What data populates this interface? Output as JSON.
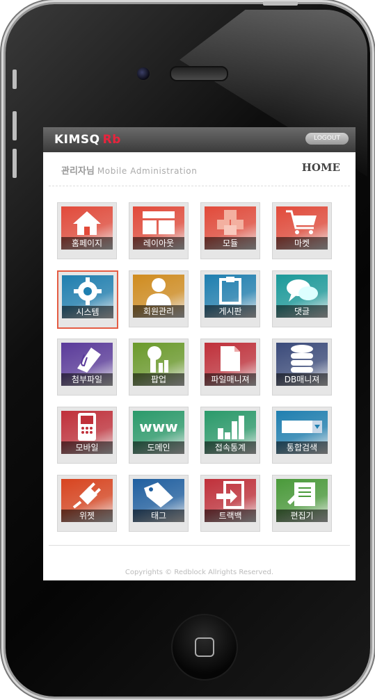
{
  "header": {
    "logo": "KIMSQ",
    "logo_rb": "Rb",
    "logout_label": "LOGOUT"
  },
  "subheader": {
    "admin_label": "관리자님",
    "admin_sub": "Mobile Administration",
    "home_label": "HOME"
  },
  "menu": {
    "items": [
      {
        "label": "홈페이지",
        "icon": "home-icon",
        "color": "#e24a3a"
      },
      {
        "label": "레이아웃",
        "icon": "layout-icon",
        "color": "#e24a3a"
      },
      {
        "label": "모듈",
        "icon": "module-boxes-icon",
        "color": "#e24a3a"
      },
      {
        "label": "마켓",
        "icon": "cart-icon",
        "color": "#e24a3a"
      },
      {
        "label": "시스템",
        "icon": "gear-icon",
        "color": "#1f7fb0",
        "selected": true
      },
      {
        "label": "회원관리",
        "icon": "user-icon",
        "color": "#d08c1f"
      },
      {
        "label": "게시판",
        "icon": "clipboard-icon",
        "color": "#1f7fb0"
      },
      {
        "label": "댓글",
        "icon": "comment-icon",
        "color": "#1b9a9a"
      },
      {
        "label": "첨부파일",
        "icon": "clip-icon",
        "color": "#5a3a9a"
      },
      {
        "label": "팝업",
        "icon": "popup-icon",
        "color": "#6a9a2a"
      },
      {
        "label": "파일매니져",
        "icon": "file-icon",
        "color": "#c0303a"
      },
      {
        "label": "DB매니져",
        "icon": "database-icon",
        "color": "#3a4a7a"
      },
      {
        "label": "모바일",
        "icon": "mobile-icon",
        "color": "#c0303a"
      },
      {
        "label": "도메인",
        "icon": "www-icon",
        "color": "#2a9a6a"
      },
      {
        "label": "접속통계",
        "icon": "bar-chart-icon",
        "color": "#2a9a6a"
      },
      {
        "label": "통합검색",
        "icon": "search-box-icon",
        "color": "#1f7fb0"
      },
      {
        "label": "위젯",
        "icon": "plug-icon",
        "color": "#d8441f"
      },
      {
        "label": "태그",
        "icon": "tag-icon",
        "color": "#1f5fa0"
      },
      {
        "label": "트랙백",
        "icon": "trackback-icon",
        "color": "#c0303a"
      },
      {
        "label": "편집기",
        "icon": "editor-icon",
        "color": "#4a9a3a"
      }
    ]
  },
  "footer": {
    "copyright": "Copyrights © Redblock Allrights Reserved."
  }
}
